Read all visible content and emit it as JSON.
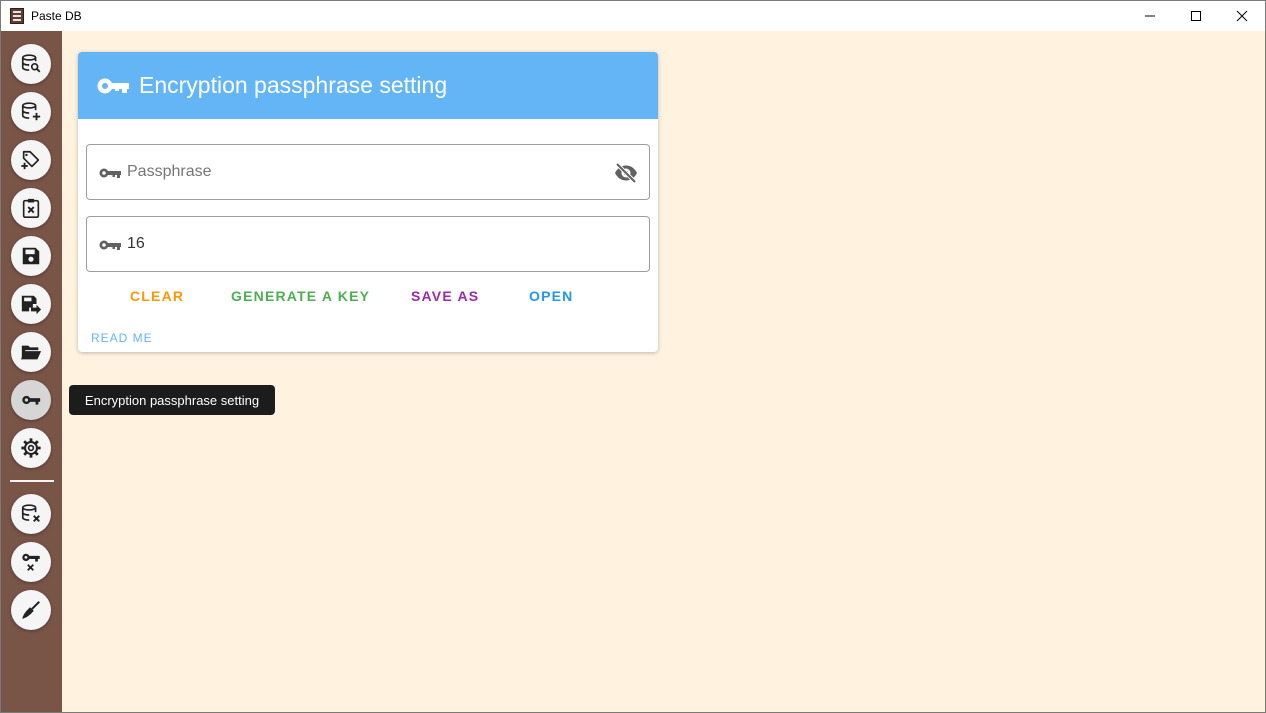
{
  "window": {
    "title": "Paste DB",
    "controls": {
      "minimize": "minimize-icon",
      "maximize": "maximize-icon",
      "close": "close-icon"
    }
  },
  "sidebar": {
    "items": [
      {
        "name": "search-database",
        "icon": "database-search-icon"
      },
      {
        "name": "add-database",
        "icon": "database-plus-icon"
      },
      {
        "name": "add-tag",
        "icon": "tag-plus-icon"
      },
      {
        "name": "clear-clipboard",
        "icon": "clipboard-remove-icon"
      },
      {
        "name": "save",
        "icon": "content-save-icon"
      },
      {
        "name": "save-as",
        "icon": "content-save-move-icon"
      },
      {
        "name": "open-folder",
        "icon": "folder-open-icon"
      },
      {
        "name": "encryption-passphrase",
        "icon": "key-icon",
        "active": true
      },
      {
        "name": "settings",
        "icon": "gear-icon"
      }
    ],
    "bottom_items": [
      {
        "name": "remove-database",
        "icon": "database-remove-icon"
      },
      {
        "name": "remove-key",
        "icon": "key-remove-icon"
      },
      {
        "name": "cleanup",
        "icon": "broom-icon"
      }
    ]
  },
  "tooltip": {
    "text": "Encryption passphrase setting"
  },
  "card": {
    "title": "Encryption passphrase setting",
    "header_color": "#64b5f6",
    "passphrase_field": {
      "placeholder": "Passphrase",
      "value": ""
    },
    "length_field": {
      "value": "16"
    },
    "actions": [
      {
        "label": "CLEAR",
        "color": "#ff9800"
      },
      {
        "label": "GENERATE A KEY",
        "color": "#4caf50"
      },
      {
        "label": "SAVE AS",
        "color": "#9c27b0"
      },
      {
        "label": "OPEN",
        "color": "#2196f3"
      }
    ],
    "readme_label": "READ ME"
  },
  "colors": {
    "sidebar": "#795548",
    "background": "#fff3e0"
  }
}
